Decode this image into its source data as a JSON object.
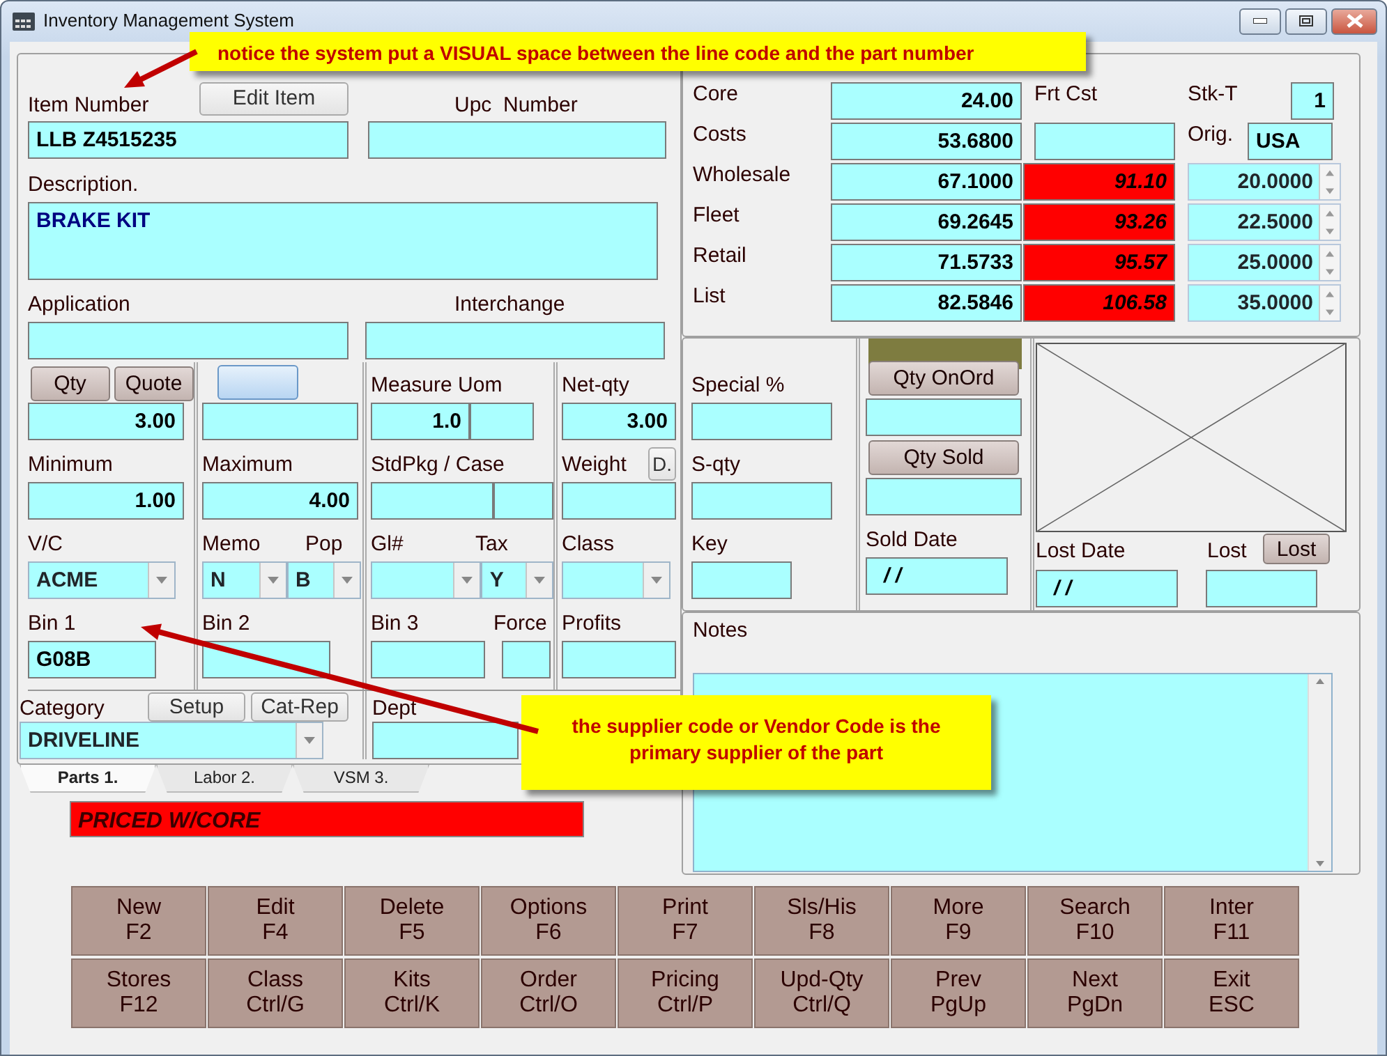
{
  "window": {
    "title": "Inventory Management System"
  },
  "callouts": [
    {
      "text": "notice the system put a VISUAL space between the line code and the part number"
    },
    {
      "text": "the supplier code or Vendor Code is the primary supplier of the part"
    }
  ],
  "item_number": {
    "label": "Item Number",
    "value": "LLB Z4515235"
  },
  "edit_item_button": "Edit Item",
  "upc": {
    "label": "Upc  Number"
  },
  "description": {
    "label": "Description.",
    "value": "BRAKE KIT"
  },
  "application": {
    "label": "Application"
  },
  "interchange": {
    "label": "Interchange"
  },
  "qty_buttons": [
    "Qty",
    "Quote"
  ],
  "qty": {
    "value": "3.00"
  },
  "minimum": {
    "label": "Minimum",
    "value": "1.00"
  },
  "vc": {
    "label": "V/C",
    "value": "ACME"
  },
  "bin1": {
    "label": "Bin 1",
    "value": "G08B"
  },
  "maximum": {
    "label": "Maximum",
    "value": "4.00"
  },
  "memo": {
    "label": "Memo",
    "value": "N"
  },
  "pop": {
    "label": "Pop",
    "value": "B"
  },
  "bin2": {
    "label": "Bin 2"
  },
  "measure_uom": {
    "label": "Measure Uom",
    "value": "1.0"
  },
  "stdpkg_case": {
    "label": "StdPkg / Case"
  },
  "gl": {
    "label": "Gl#"
  },
  "tax": {
    "label": "Tax",
    "value": "Y"
  },
  "bin3": {
    "label": "Bin 3"
  },
  "force": {
    "label": "Force"
  },
  "net_qty": {
    "label": "Net-qty",
    "value": "3.00"
  },
  "weight": {
    "label": "Weight",
    "button": "D."
  },
  "class_field": {
    "label": "Class"
  },
  "profits": {
    "label": "Profits"
  },
  "category": {
    "label": "Category",
    "buttons": [
      "Setup",
      "Cat-Rep"
    ],
    "value": "DRIVELINE"
  },
  "dept": {
    "label": "Dept"
  },
  "tabs": [
    {
      "label": "Parts 1.",
      "selected": true
    },
    {
      "label": "Labor 2.",
      "selected": false
    },
    {
      "label": "VSM 3.",
      "selected": false
    }
  ],
  "status_banner": "PRICED W/CORE",
  "core": {
    "label": "Core",
    "value": "24.00"
  },
  "frt_cst": {
    "label": "Frt Cst"
  },
  "stk_t": {
    "label": "Stk-T",
    "value": "1"
  },
  "costs": {
    "label": "Costs",
    "value": "53.6800"
  },
  "orig": {
    "label": "Orig.",
    "value": "USA"
  },
  "price_levels": [
    {
      "label": "Wholesale",
      "value": "67.1000",
      "alert_value": "91.10",
      "percent": "20.0000"
    },
    {
      "label": "Fleet",
      "value": "69.2645",
      "alert_value": "93.26",
      "percent": "22.5000"
    },
    {
      "label": "Retail",
      "value": "71.5733",
      "alert_value": "95.57",
      "percent": "25.0000"
    },
    {
      "label": "List",
      "value": "82.5846",
      "alert_value": "106.58",
      "percent": "35.0000"
    }
  ],
  "special": {
    "label": "Special %"
  },
  "s_qty": {
    "label": "S-qty"
  },
  "key": {
    "label": "Key"
  },
  "qty_on_order_button": "Qty OnOrd",
  "qty_sold_button": "Qty Sold",
  "sold_date": {
    "label": "Sold Date",
    "value": "/ /"
  },
  "lost_date": {
    "label": "Lost Date",
    "value": "/ /"
  },
  "lost": {
    "label": "Lost",
    "button": "Lost"
  },
  "notes": {
    "label": "Notes"
  },
  "function_keys": [
    {
      "label": "New",
      "key": "F2"
    },
    {
      "label": "Edit",
      "key": "F4"
    },
    {
      "label": "Delete",
      "key": "F5"
    },
    {
      "label": "Options",
      "key": "F6"
    },
    {
      "label": "Print",
      "key": "F7"
    },
    {
      "label": "Sls/His",
      "key": "F8"
    },
    {
      "label": "More",
      "key": "F9"
    },
    {
      "label": "Search",
      "key": "F10"
    },
    {
      "label": "Inter",
      "key": "F11"
    },
    {
      "label": "Stores",
      "key": "F12"
    },
    {
      "label": "Class",
      "key": "Ctrl/G"
    },
    {
      "label": "Kits",
      "key": "Ctrl/K"
    },
    {
      "label": "Order",
      "key": "Ctrl/O"
    },
    {
      "label": "Pricing",
      "key": "Ctrl/P"
    },
    {
      "label": "Upd-Qty",
      "key": "Ctrl/Q"
    },
    {
      "label": "Prev",
      "key": "PgUp"
    },
    {
      "label": "Next",
      "key": "PgDn"
    },
    {
      "label": "Exit",
      "key": "ESC"
    }
  ]
}
